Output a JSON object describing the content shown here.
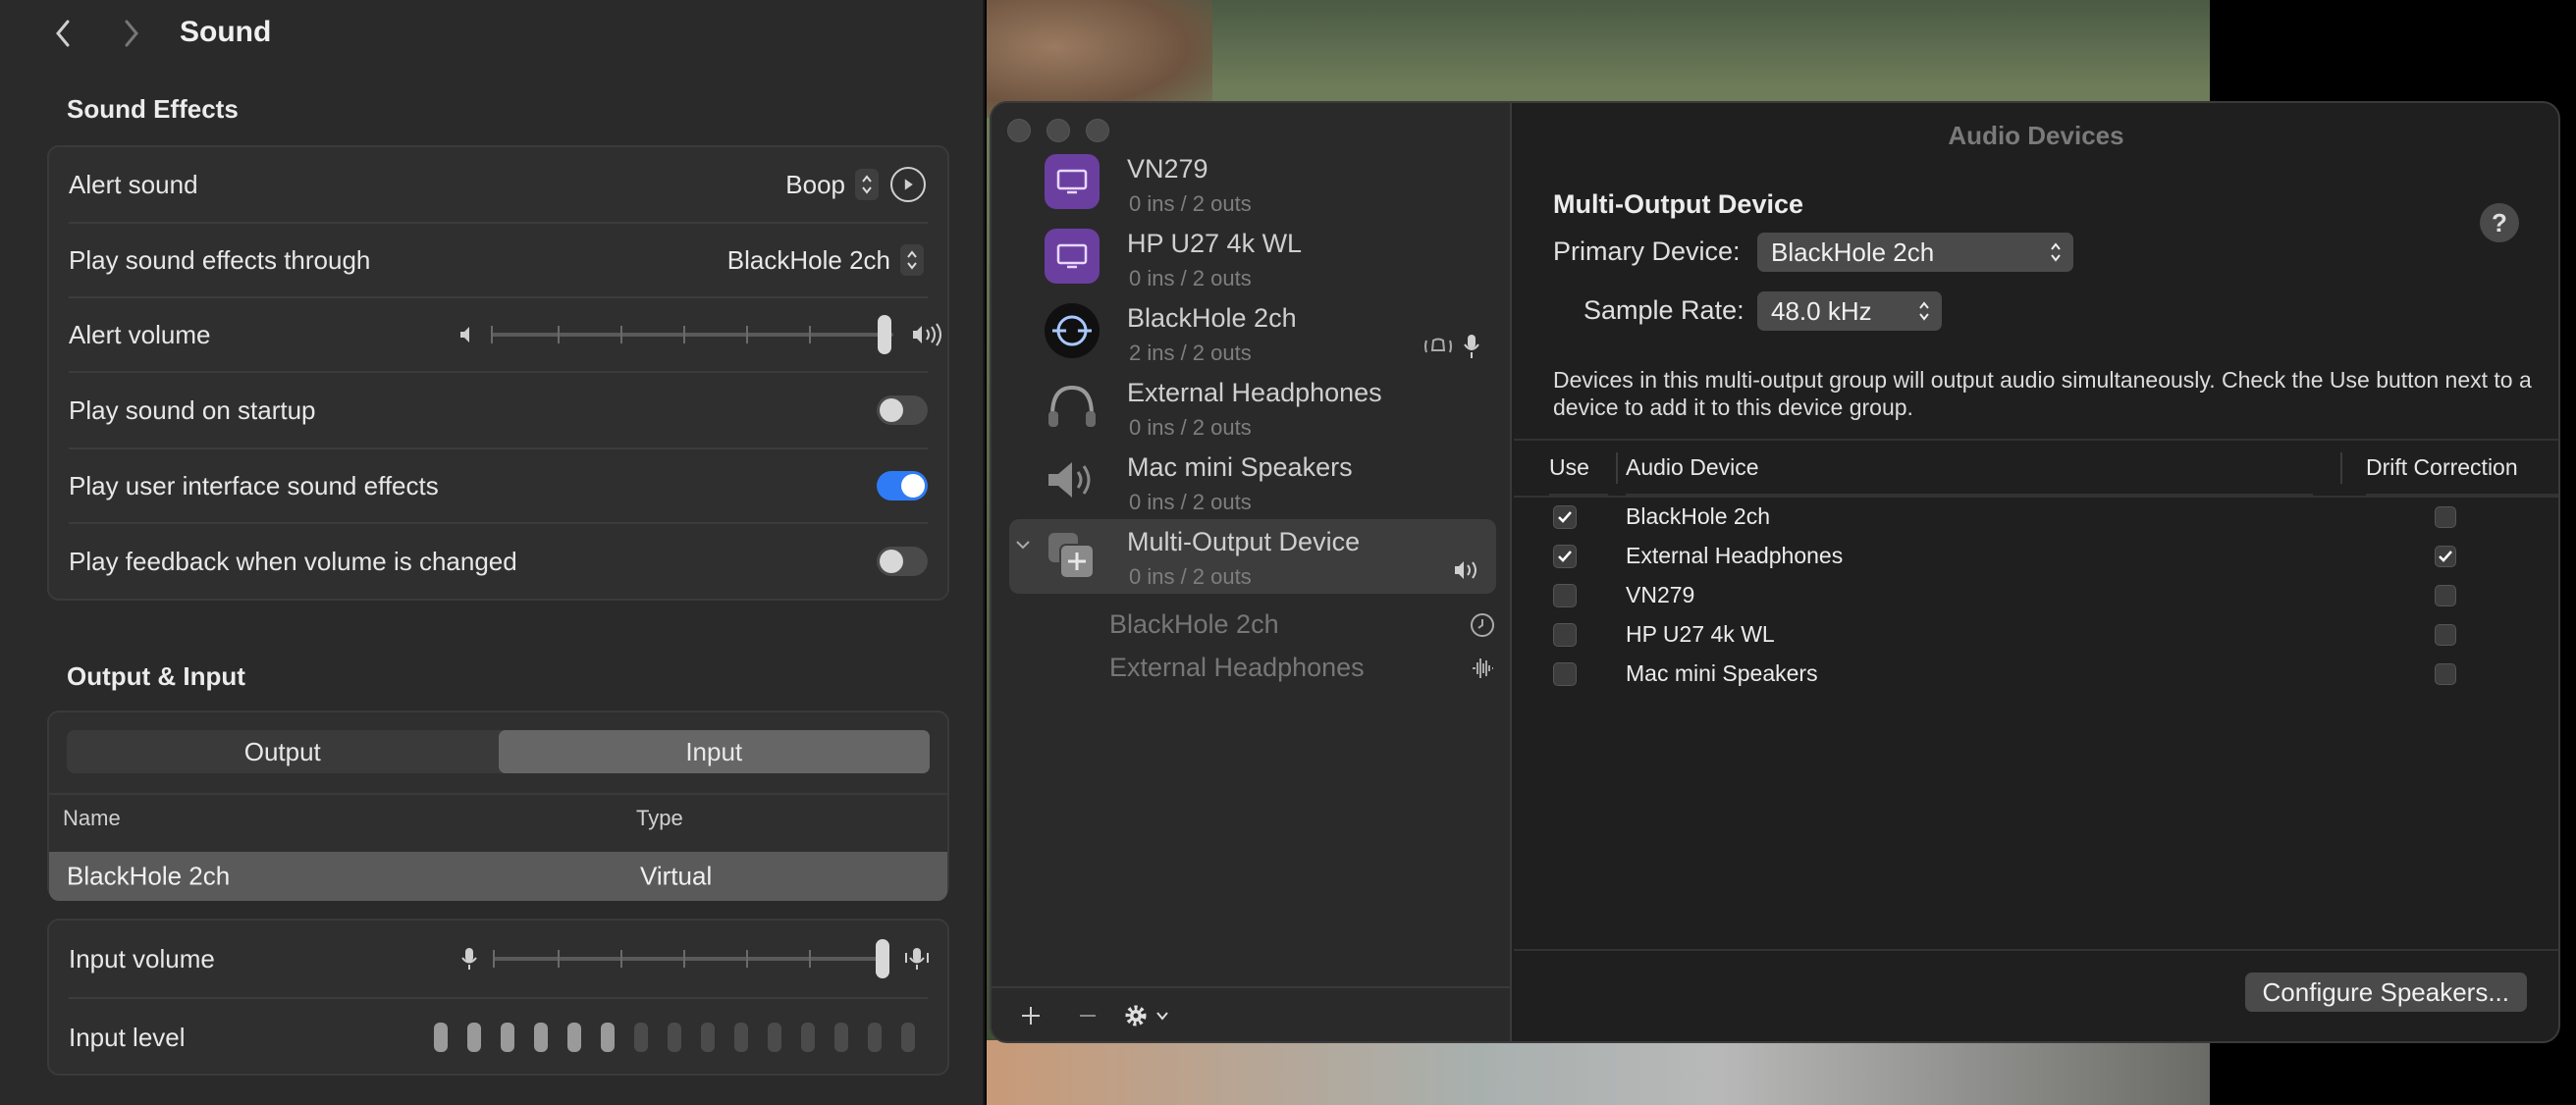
{
  "settings": {
    "title": "Sound",
    "sound_effects": {
      "section_title": "Sound Effects",
      "alert_sound": {
        "label": "Alert sound",
        "value": "Boop"
      },
      "play_through": {
        "label": "Play sound effects through",
        "value": "BlackHole 2ch"
      },
      "alert_volume": {
        "label": "Alert volume",
        "level": 1.0
      },
      "startup_sound": {
        "label": "Play sound on startup",
        "on": false
      },
      "ui_sounds": {
        "label": "Play user interface sound effects",
        "on": true
      },
      "volume_feedback": {
        "label": "Play feedback when volume is changed",
        "on": false
      }
    },
    "output_input": {
      "section_title": "Output & Input",
      "tabs": [
        {
          "label": "Output",
          "active": false
        },
        {
          "label": "Input",
          "active": true
        }
      ],
      "table": {
        "columns": [
          "Name",
          "Type"
        ],
        "rows": [
          {
            "name": "BlackHole 2ch",
            "type": "Virtual",
            "selected": true
          }
        ]
      },
      "input_volume": {
        "label": "Input volume",
        "level": 1.0
      },
      "input_level": {
        "label": "Input level",
        "bars_total": 15,
        "bars_lit": 6
      }
    }
  },
  "audio_devices": {
    "window_title": "Audio Devices",
    "devices": [
      {
        "name": "VN279",
        "io": "0 ins / 2 outs",
        "icon": "display-icon"
      },
      {
        "name": "HP U27 4k WL",
        "io": "0 ins / 2 outs",
        "icon": "display-icon"
      },
      {
        "name": "BlackHole 2ch",
        "io": "2 ins / 2 outs",
        "icon": "blackhole-icon"
      },
      {
        "name": "External Headphones",
        "io": "0 ins / 2 outs",
        "icon": "headphones-icon"
      },
      {
        "name": "Mac mini Speakers",
        "io": "0 ins / 2 outs",
        "icon": "speaker-icon"
      },
      {
        "name": "Multi-Output Device",
        "io": "0 ins / 2 outs",
        "icon": "multi-output-icon",
        "selected": true,
        "expanded": true
      }
    ],
    "sub_devices": [
      {
        "name": "BlackHole 2ch",
        "icon": "clock-icon"
      },
      {
        "name": "External Headphones",
        "icon": "waveform-icon"
      }
    ],
    "detail": {
      "title": "Multi-Output Device",
      "primary_device_label": "Primary Device:",
      "primary_device_value": "BlackHole 2ch",
      "sample_rate_label": "Sample Rate:",
      "sample_rate_value": "48.0 kHz",
      "help": "?",
      "description": "Devices in this multi-output group will output audio simultaneously. Check the Use button next to a device to add it to this device group.",
      "columns": {
        "use": "Use",
        "device": "Audio Device",
        "drift": "Drift Correction"
      },
      "rows": [
        {
          "device": "BlackHole 2ch",
          "use": true,
          "drift": false
        },
        {
          "device": "External Headphones",
          "use": true,
          "drift": true
        },
        {
          "device": "VN279",
          "use": false,
          "drift": false
        },
        {
          "device": "HP U27 4k WL",
          "use": false,
          "drift": false
        },
        {
          "device": "Mac mini Speakers",
          "use": false,
          "drift": false
        }
      ],
      "configure_button": "Configure Speakers..."
    }
  },
  "colors": {
    "accent": "#2f7bf5",
    "window_bg": "#1f1f1f",
    "sidebar_bg": "#2a2a2a",
    "device_purple": "#6b3fa0"
  }
}
